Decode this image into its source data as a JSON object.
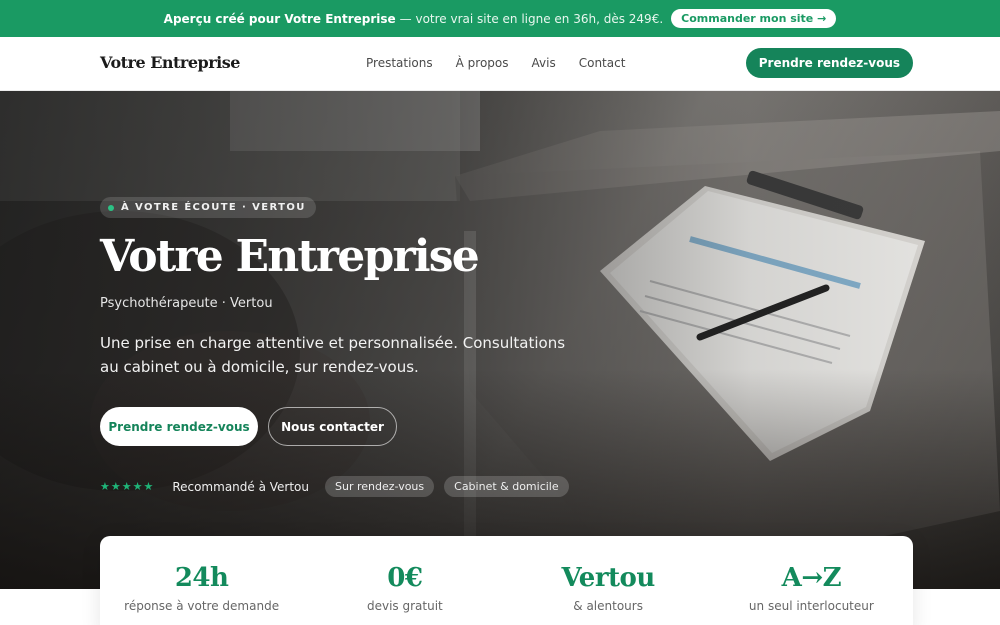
{
  "promo": {
    "strong_text": "Aperçu créé pour Votre Entreprise",
    "rest_text": "— votre vrai site en ligne en 36h, dès 249€.",
    "cta_label": "Commander mon site →"
  },
  "nav": {
    "brand": "Votre Entreprise",
    "links": [
      "Prestations",
      "À propos",
      "Avis",
      "Contact"
    ],
    "cta_label": "Prendre rendez-vous"
  },
  "hero": {
    "tagline": "À VOTRE ÉCOUTE · VERTOU",
    "title": "Votre Entreprise",
    "subtitle": "Psychothérapeute · Vertou",
    "description": "Une prise en charge attentive et personnalisée. Consultations au cabinet ou à domicile, sur rendez-vous.",
    "primary_cta": "Prendre rendez-vous",
    "secondary_cta": "Nous contacter",
    "stars": "★★★★★",
    "recommendation": "Recommandé à Vertou",
    "chips": [
      "Sur rendez-vous",
      "Cabinet & domicile"
    ]
  },
  "stats": [
    {
      "value": "24h",
      "label": "réponse à votre demande"
    },
    {
      "value": "0€",
      "label": "devis gratuit"
    },
    {
      "value": "Vertou",
      "label": "& alentours"
    },
    {
      "value": "A→Z",
      "label": "un seul interlocuteur"
    }
  ],
  "colors": {
    "brand_green": "#15845a",
    "banner_green": "#1a9a63"
  }
}
